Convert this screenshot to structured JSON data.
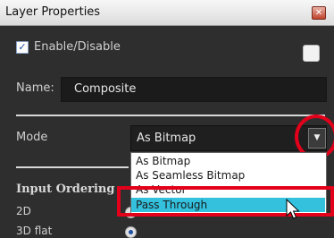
{
  "window": {
    "title": "Layer Properties",
    "close_glyph": "✕"
  },
  "enable": {
    "label": "Enable/Disable",
    "checked": true,
    "check_glyph": "✓"
  },
  "name": {
    "label": "Name:",
    "value": "Composite"
  },
  "mode": {
    "label": "Mode",
    "selected": "As Bitmap",
    "arrow_glyph": "▼",
    "options": [
      "As Bitmap",
      "As Seamless Bitmap",
      "As Vector",
      "Pass Through"
    ],
    "highlighted": "Pass Through"
  },
  "input_ordering": {
    "header": "Input Ordering",
    "options": [
      {
        "label": "2D",
        "selected": false
      },
      {
        "label": "3D flat",
        "selected": true
      }
    ]
  },
  "annotation_color": "#e2001a",
  "highlight_color": "#33c1de"
}
